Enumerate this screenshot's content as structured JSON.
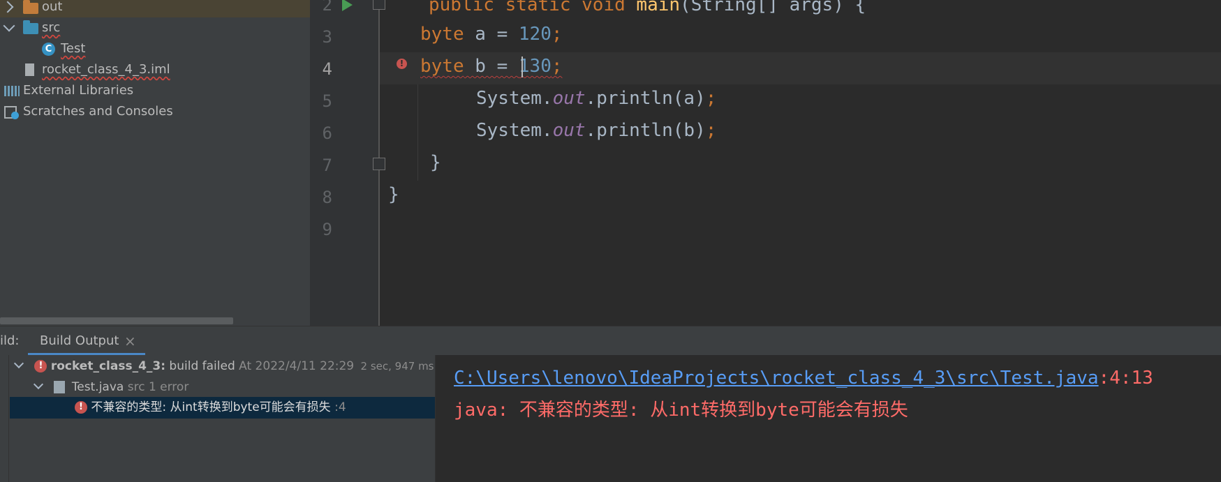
{
  "project_tree": {
    "items": [
      {
        "label": "out"
      },
      {
        "label": "src"
      },
      {
        "label": "Test"
      },
      {
        "label": "rocket_class_4_3.iml"
      },
      {
        "label": "External Libraries"
      },
      {
        "label": "Scratches and Consoles"
      }
    ]
  },
  "editor": {
    "lines": [
      {
        "number": "2",
        "text": "public static void main(String[] args) {"
      },
      {
        "number": "3"
      },
      {
        "number": "4"
      },
      {
        "number": "5"
      },
      {
        "number": "6"
      },
      {
        "number": "7",
        "text": "}"
      },
      {
        "number": "8",
        "text": "}"
      },
      {
        "number": "9"
      }
    ],
    "tokens": {
      "byte": "byte",
      "a_decl": " a = ",
      "b_decl": " b = ",
      "val_a": "120",
      "val_b": "130",
      "semi": ";",
      "system": "System.",
      "out": "out",
      "println_a": ".println(a)",
      "println_b": ".println(b)"
    }
  },
  "build": {
    "left_label": "ild:",
    "tab_label": "Build Output",
    "tab_close": "×",
    "root": {
      "name": "rocket_class_4_3:",
      "status": " build failed",
      "time": "At 2022/4/11 22:29",
      "duration": "2 sec, 947 ms"
    },
    "file": {
      "name": "Test.java",
      "detail": "src 1 error"
    },
    "error": {
      "message": "不兼容的类型: 从int转换到byte可能会有损失",
      "line": ":4"
    },
    "console": {
      "path": "C:\\Users\\lenovo\\IdeaProjects\\rocket_class_4_3\\src\\Test.java",
      "position": ":4:13",
      "message": "java: 不兼容的类型: 从int转换到byte可能会有损失"
    }
  },
  "colors": {
    "error": "#c75450",
    "link": "#589df6",
    "keyword": "#cc7832",
    "number": "#6897bb"
  }
}
